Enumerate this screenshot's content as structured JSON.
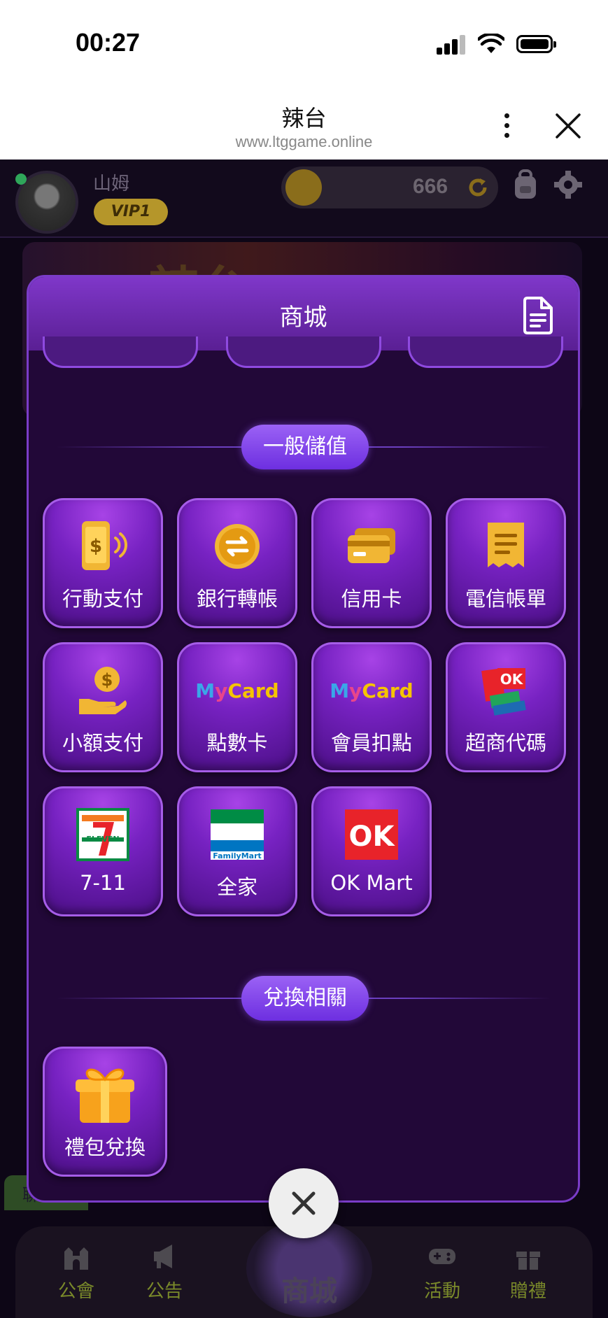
{
  "status_bar": {
    "time": "00:27"
  },
  "browser": {
    "title": "辣台",
    "url": "www.ltggame.online"
  },
  "player": {
    "name": "山姆",
    "vip": "VIP1",
    "coins": "666"
  },
  "banner": {
    "title": "辣台"
  },
  "modal": {
    "title": "商城",
    "sections": {
      "general": {
        "label": "一般儲值",
        "items": [
          {
            "label": "行動支付",
            "icon": "mobile-pay-icon"
          },
          {
            "label": "銀行轉帳",
            "icon": "bank-transfer-icon"
          },
          {
            "label": "信用卡",
            "icon": "credit-card-icon"
          },
          {
            "label": "電信帳單",
            "icon": "telecom-bill-icon"
          },
          {
            "label": "小額支付",
            "icon": "micropayment-icon"
          },
          {
            "label": "點數卡",
            "icon": "mycard-icon"
          },
          {
            "label": "會員扣點",
            "icon": "mycard-member-icon"
          },
          {
            "label": "超商代碼",
            "icon": "store-code-icon"
          },
          {
            "label": "7-11",
            "icon": "seven-eleven-icon"
          },
          {
            "label": "全家",
            "icon": "familymart-icon"
          },
          {
            "label": "OK Mart",
            "icon": "okmart-icon"
          }
        ]
      },
      "exchange": {
        "label": "兌換相關",
        "items": [
          {
            "label": "禮包兌換",
            "icon": "gift-box-icon"
          }
        ]
      }
    }
  },
  "logos": {
    "mycard": "MyCard",
    "seven": "ELEVEN",
    "familymart": "FamilyMart",
    "ok": "OK"
  },
  "nav": {
    "guild": "公會",
    "notice": "公告",
    "shop": "商城",
    "events": "活動",
    "gift": "贈禮"
  },
  "chat_tab": "聊天",
  "colors": {
    "modal_bg": "#220838",
    "accent": "#7f37c9",
    "nav_active": "#c9a322"
  }
}
